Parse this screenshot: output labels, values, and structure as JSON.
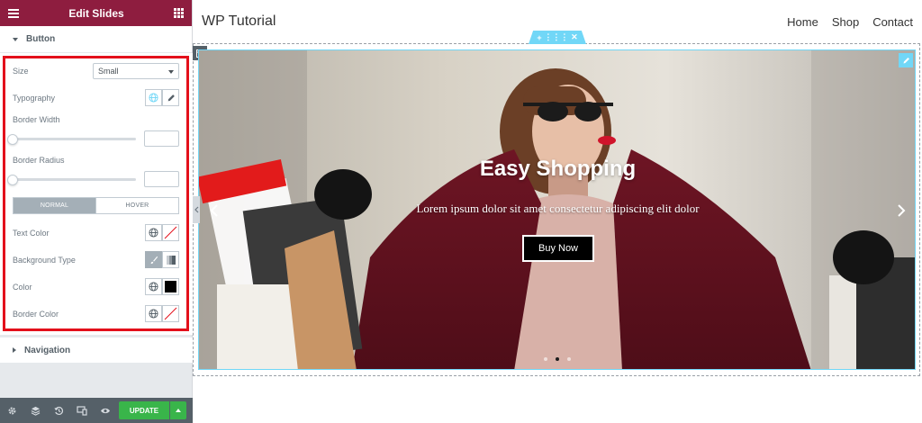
{
  "panel": {
    "title": "Edit Slides",
    "button_section": "Button",
    "navigation_section": "Navigation",
    "size": {
      "label": "Size",
      "value": "Small"
    },
    "typography": {
      "label": "Typography"
    },
    "border_width": {
      "label": "Border Width",
      "value": ""
    },
    "border_radius": {
      "label": "Border Radius",
      "value": ""
    },
    "tabs": {
      "normal": "NORMAL",
      "hover": "HOVER",
      "active": "NORMAL"
    },
    "text_color": {
      "label": "Text Color"
    },
    "background_type": {
      "label": "Background Type"
    },
    "color": {
      "label": "Color",
      "swatch": "#000000"
    },
    "border_color": {
      "label": "Border Color"
    },
    "footer": {
      "icons": [
        "gear-icon",
        "layers-icon",
        "history-icon",
        "responsive-icon",
        "eye-icon"
      ],
      "update_label": "UPDATE"
    }
  },
  "preview": {
    "site_title": "WP Tutorial",
    "nav": [
      "Home",
      "Shop",
      "Contact"
    ],
    "slide": {
      "heading": "Easy Shopping",
      "description": "Lorem ipsum dolor sit amet consectetur adipiscing elit dolor",
      "button_label": "Buy Now",
      "dots_total": 3,
      "dots_active": 2
    }
  },
  "colors": {
    "panel_header": "#8e1d3f",
    "highlight": "#e3101b",
    "update_button": "#39b54a",
    "edit_handle": "#71d7f7"
  }
}
